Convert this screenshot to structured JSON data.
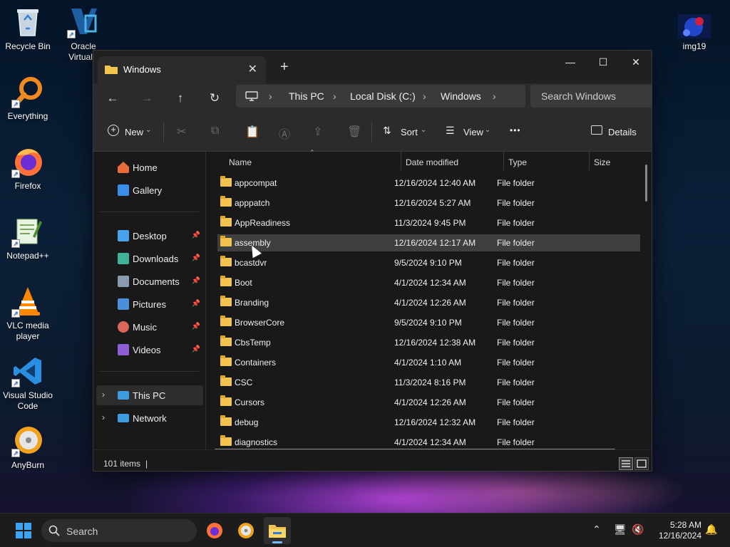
{
  "desktop": {
    "icons": [
      {
        "label": "Recycle Bin",
        "icon": "recycle-bin-icon"
      },
      {
        "label": "Oracle VirtualB",
        "icon": "virtualbox-icon"
      },
      {
        "label": "Everything",
        "icon": "everything-search-icon"
      },
      {
        "label": "Firefox",
        "icon": "firefox-icon"
      },
      {
        "label": "Notepad++",
        "icon": "notepadpp-icon"
      },
      {
        "label": "VLC media player",
        "icon": "vlc-icon"
      },
      {
        "label": "Visual Studio Code",
        "icon": "vscode-icon"
      },
      {
        "label": "AnyBurn",
        "icon": "anyburn-icon"
      },
      {
        "label": "img19",
        "icon": "image-file-icon"
      }
    ]
  },
  "window": {
    "tab_title": "Windows",
    "tab_close": "✕",
    "new_tab": "+",
    "controls": {
      "minimize": "—",
      "maximize": "☐",
      "close": "✕"
    },
    "nav": {
      "back": "←",
      "forward": "→",
      "up": "↑",
      "refresh": "↻"
    },
    "breadcrumb": [
      "This PC",
      "Local Disk (C:)",
      "Windows"
    ],
    "search_placeholder": "Search Windows",
    "commands": {
      "new": "New",
      "sort": "Sort",
      "view": "View",
      "more": "•••",
      "details": "Details"
    },
    "sidebar": {
      "quick": [
        {
          "label": "Home",
          "icon": "home-icon",
          "color": "#e86b3a"
        },
        {
          "label": "Gallery",
          "icon": "gallery-icon",
          "color": "#3b8ee8"
        }
      ],
      "pinned": [
        {
          "label": "Desktop",
          "icon": "desktop-folder-icon",
          "color": "#4aa3ea"
        },
        {
          "label": "Downloads",
          "icon": "downloads-folder-icon",
          "color": "#3fb39a"
        },
        {
          "label": "Documents",
          "icon": "documents-folder-icon",
          "color": "#8a9bb0"
        },
        {
          "label": "Pictures",
          "icon": "pictures-folder-icon",
          "color": "#4a90d9"
        },
        {
          "label": "Music",
          "icon": "music-folder-icon",
          "color": "#d9675a"
        },
        {
          "label": "Videos",
          "icon": "videos-folder-icon",
          "color": "#8d5fd3"
        }
      ],
      "tree": [
        {
          "label": "This PC",
          "icon": "this-pc-icon",
          "color": "#3d9be0"
        },
        {
          "label": "Network",
          "icon": "network-icon",
          "color": "#3d9be0"
        }
      ],
      "pin_glyph": "📌"
    },
    "columns": {
      "name": "Name",
      "date": "Date modified",
      "type": "Type",
      "size": "Size"
    },
    "files": [
      {
        "name": "appcompat",
        "date": "12/16/2024 12:40 AM",
        "type": "File folder"
      },
      {
        "name": "apppatch",
        "date": "12/16/2024 5:27 AM",
        "type": "File folder"
      },
      {
        "name": "AppReadiness",
        "date": "11/3/2024 9:45 PM",
        "type": "File folder"
      },
      {
        "name": "assembly",
        "date": "12/16/2024 12:17 AM",
        "type": "File folder"
      },
      {
        "name": "bcastdvr",
        "date": "9/5/2024 9:10 PM",
        "type": "File folder"
      },
      {
        "name": "Boot",
        "date": "4/1/2024 12:34 AM",
        "type": "File folder"
      },
      {
        "name": "Branding",
        "date": "4/1/2024 12:26 AM",
        "type": "File folder"
      },
      {
        "name": "BrowserCore",
        "date": "9/5/2024 9:10 PM",
        "type": "File folder"
      },
      {
        "name": "CbsTemp",
        "date": "12/16/2024 12:38 AM",
        "type": "File folder"
      },
      {
        "name": "Containers",
        "date": "4/1/2024 1:10 AM",
        "type": "File folder"
      },
      {
        "name": "CSC",
        "date": "11/3/2024 8:16 PM",
        "type": "File folder"
      },
      {
        "name": "Cursors",
        "date": "4/1/2024 12:26 AM",
        "type": "File folder"
      },
      {
        "name": "debug",
        "date": "12/16/2024 12:32 AM",
        "type": "File folder"
      },
      {
        "name": "diagnostics",
        "date": "4/1/2024 12:34 AM",
        "type": "File folder"
      }
    ],
    "selected_file": "assembly",
    "status": {
      "item_count": "101 items",
      "caret": "|"
    }
  },
  "taskbar": {
    "search_label": "Search",
    "time": "5:28 AM",
    "date": "12/16/2024"
  },
  "colors": {
    "accent": "#77b7ff",
    "folder": "#f2c34e"
  }
}
